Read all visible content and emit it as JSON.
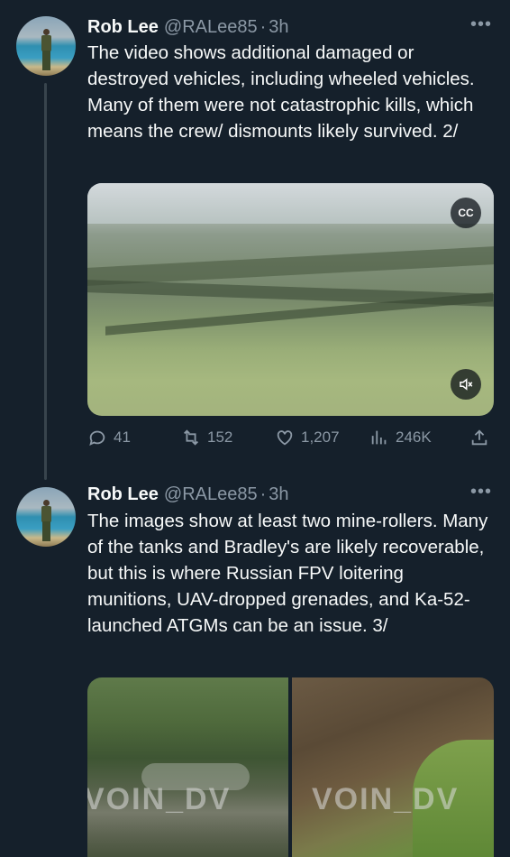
{
  "tweets": [
    {
      "author_name": "Rob Lee",
      "handle": "@RALee85",
      "separator": "·",
      "time": "3h",
      "more_label": "•••",
      "text": "The video shows additional damaged or destroyed vehicles, including wheeled vehicles. Many of them were not catastrophic kills, which means the crew/ dismounts likely survived. 2/",
      "media": {
        "type": "video",
        "cc_label": "CC",
        "mute_icon": "mute-icon"
      },
      "stats": {
        "replies": "41",
        "retweets": "152",
        "likes": "1,207",
        "views": "246K"
      }
    },
    {
      "author_name": "Rob Lee",
      "handle": "@RALee85",
      "separator": "·",
      "time": "3h",
      "more_label": "•••",
      "text": "The images show at least two mine-rollers. Many of the tanks and Bradley's are likely recoverable, but this is where Russian FPV loitering munitions, UAV-dropped grenades, and Ka-52-launched ATGMs can be an issue. 3/",
      "media": {
        "type": "photos",
        "watermark_left": "VOIN_DV",
        "watermark_right": "VOIN_DV"
      }
    }
  ],
  "colors": {
    "background": "#15202b",
    "text": "#f7f9f9",
    "secondary": "#8b98a5",
    "thread_line": "#38444d"
  }
}
